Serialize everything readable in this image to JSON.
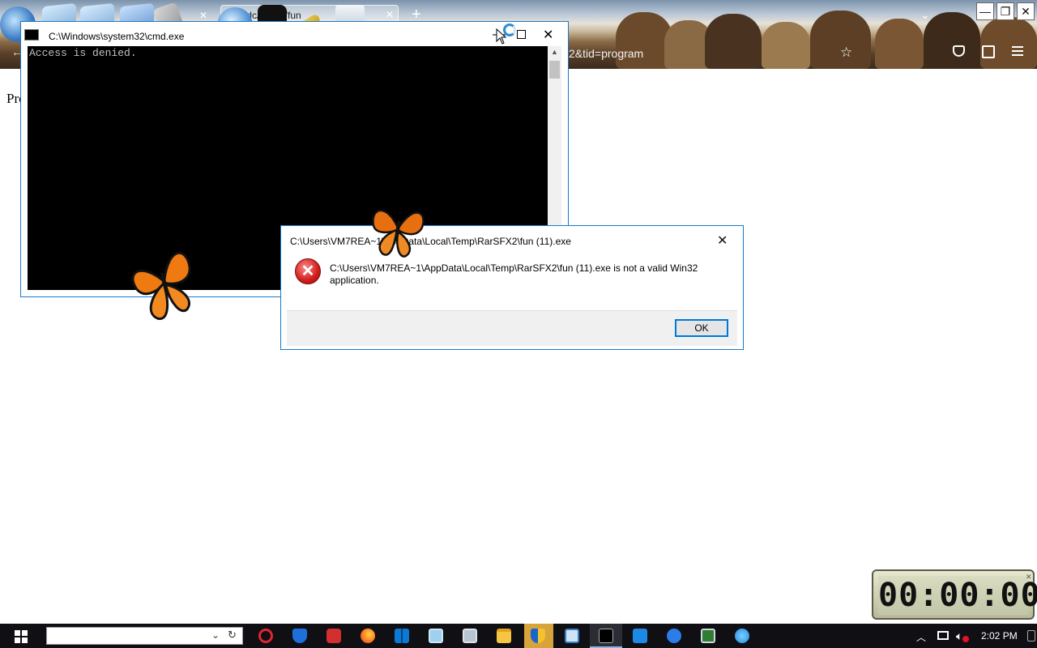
{
  "browser": {
    "tab_title": "…/cdc/GM…/fun",
    "url_partial": "2&tid=program",
    "new_tab": "+"
  },
  "desktop_toys": [
    "globe-icon",
    "folder-icon",
    "folder-icon",
    "folder-icon",
    "tools-icon",
    "network-globe-icon",
    "tshirt-icon",
    "wand-icon",
    "recycle-bin-icon"
  ],
  "page": {
    "fragment": "Pro"
  },
  "cmd": {
    "title": "C:\\Windows\\system32\\cmd.exe",
    "output": "Access is denied."
  },
  "error_dialog": {
    "title": "C:\\Users\\VM7REA~1\\AppData\\Local\\Temp\\RarSFX2\\fun (11).exe",
    "message": "C:\\Users\\VM7REA~1\\AppData\\Local\\Temp\\RarSFX2\\fun (11).exe is not a valid Win32 application.",
    "ok_label": "OK",
    "icon": "error-icon"
  },
  "clock_widget": {
    "display": "00:00:00"
  },
  "taskbar": {
    "search_value": "",
    "time": "2:02 PM",
    "pinned": [
      "opera-icon",
      "shield-icon",
      "camera-icon",
      "firefox-icon",
      "store-icon",
      "monitor-icon",
      "network-folder-icon",
      "file-explorer-icon",
      "security-shield-icon",
      "note-icon",
      "cmd-icon",
      "media-player-icon",
      "download-icon",
      "terminal-icon",
      "browser-icon"
    ]
  },
  "colors": {
    "accent": "#0078d7",
    "error_red": "#d01c1c",
    "taskbar": "#0f0f14",
    "console_bg": "#000000",
    "console_text": "#c0c0c0"
  }
}
